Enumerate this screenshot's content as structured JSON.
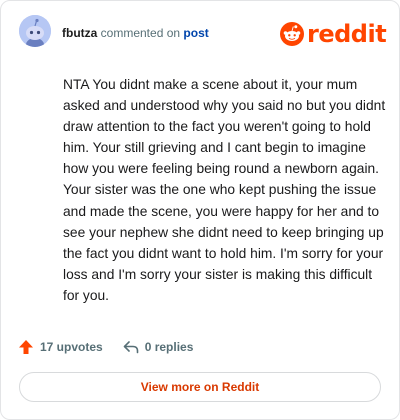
{
  "comment": {
    "username": "fbutza",
    "commented_on_text": "commented on",
    "post_link_text": "post",
    "body": "NTA You didnt make a scene about it, your mum asked and understood why you said no but you didnt draw attention to the fact you weren't going to hold him. Your still grieving and I cant begin to imagine how you were feeling being round a newborn again. Your sister was the one who kept pushing the issue and made the scene, you were happy for her and to see your nephew she didnt need to keep bringing up the fact you didnt want to hold him. I'm sorry for your loss and I'm sorry your sister is making this difficult for you."
  },
  "brand": {
    "logo_text": "reddit",
    "logo_icon": "reddit-snoo-icon",
    "color": "#ff4500"
  },
  "actions": {
    "upvotes_label": "17 upvotes",
    "upvote_icon": "upvote-arrow-icon",
    "replies_label": "0 replies",
    "reply_icon": "reply-arrow-icon"
  },
  "footer": {
    "view_more_label": "View more on Reddit"
  }
}
